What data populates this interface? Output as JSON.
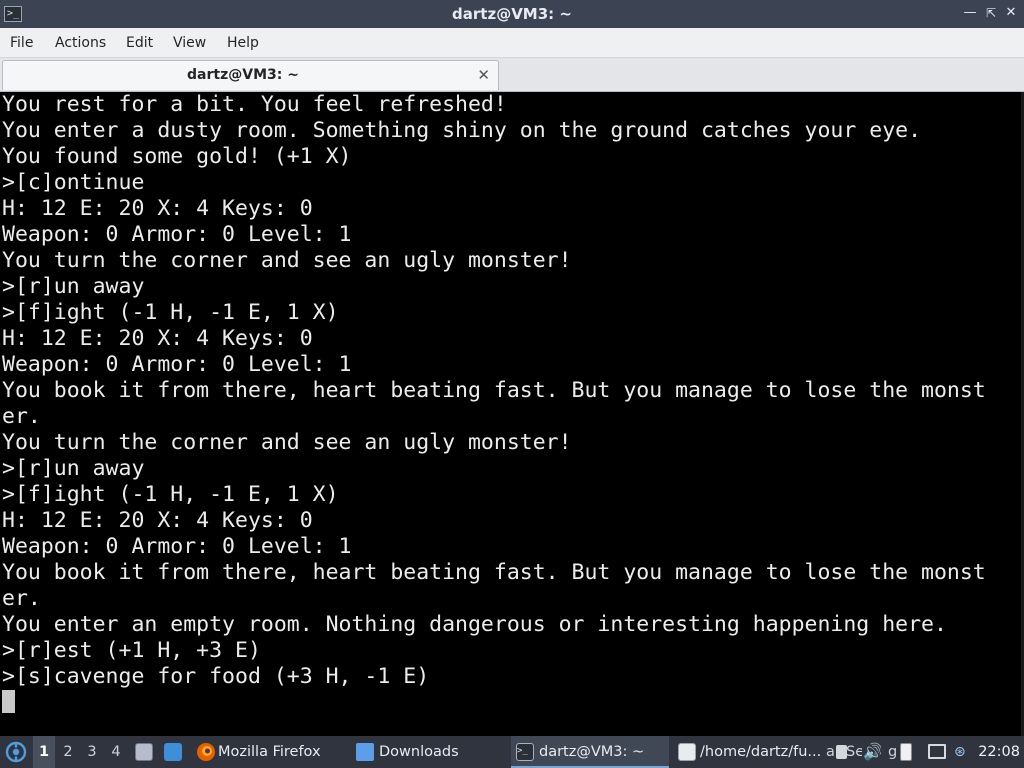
{
  "window": {
    "title": "dartz@VM3: ~",
    "icon": "terminal-icon",
    "controls": {
      "minimize": "minimize-icon",
      "maximize": "restore-icon",
      "close": "close-icon"
    }
  },
  "menu": {
    "file": "File",
    "actions": "Actions",
    "edit": "Edit",
    "view": "View",
    "help": "Help"
  },
  "tab": {
    "label": "dartz@VM3: ~",
    "close_icon": "close-icon"
  },
  "terminal": {
    "lines": [
      "You rest for a bit. You feel refreshed!",
      "You enter a dusty room. Something shiny on the ground catches your eye.",
      "You found some gold! (+1 X)",
      ">[c]ontinue",
      "H: 12 E: 20 X: 4 Keys: 0",
      "Weapon: 0 Armor: 0 Level: 1",
      "You turn the corner and see an ugly monster!",
      ">[r]un away",
      ">[f]ight (-1 H, -1 E, 1 X)",
      "H: 12 E: 20 X: 4 Keys: 0",
      "Weapon: 0 Armor: 0 Level: 1",
      "You book it from there, heart beating fast. But you manage to lose the monst",
      "er.",
      "You turn the corner and see an ugly monster!",
      ">[r]un away",
      ">[f]ight (-1 H, -1 E, 1 X)",
      "H: 12 E: 20 X: 4 Keys: 0",
      "Weapon: 0 Armor: 0 Level: 1",
      "You book it from there, heart beating fast. But you manage to lose the monst",
      "er.",
      "You enter an empty room. Nothing dangerous or interesting happening here.",
      ">[r]est (+1 H, +3 E)",
      ">[s]cavenge for food (+3 H, -1 E)",
      ""
    ]
  },
  "taskbar": {
    "start_icon": "start-menu-icon",
    "workspaces": [
      "1",
      "2",
      "3",
      "4"
    ],
    "active_workspace": "1",
    "launchers": [
      "file-manager-icon",
      "show-desktop-icon"
    ],
    "apps": [
      {
        "label": "Mozilla Firefox",
        "icon": "firefox-icon"
      },
      {
        "label": "Downloads",
        "icon": "folder-icon"
      },
      {
        "label": "dartz@VM3: ~",
        "icon": "terminal-icon",
        "active": true
      },
      {
        "label": "/home/dartz/fu...",
        "icon": "text-editor-icon"
      }
    ],
    "tray": {
      "partial_labels": [
        "a",
        "Se",
        "g"
      ],
      "icons": [
        "volume-icon",
        "battery-icon",
        "network-icon",
        "bluetooth-icon"
      ]
    },
    "clock": "22:08"
  },
  "colors": {
    "titlebar_bg": "#3c4454",
    "menubar_bg": "#eff0f1",
    "terminal_bg": "#000000",
    "terminal_fg": "#ececec",
    "taskbar_bg": "#2f343f",
    "accent": "#7aa6d6"
  }
}
